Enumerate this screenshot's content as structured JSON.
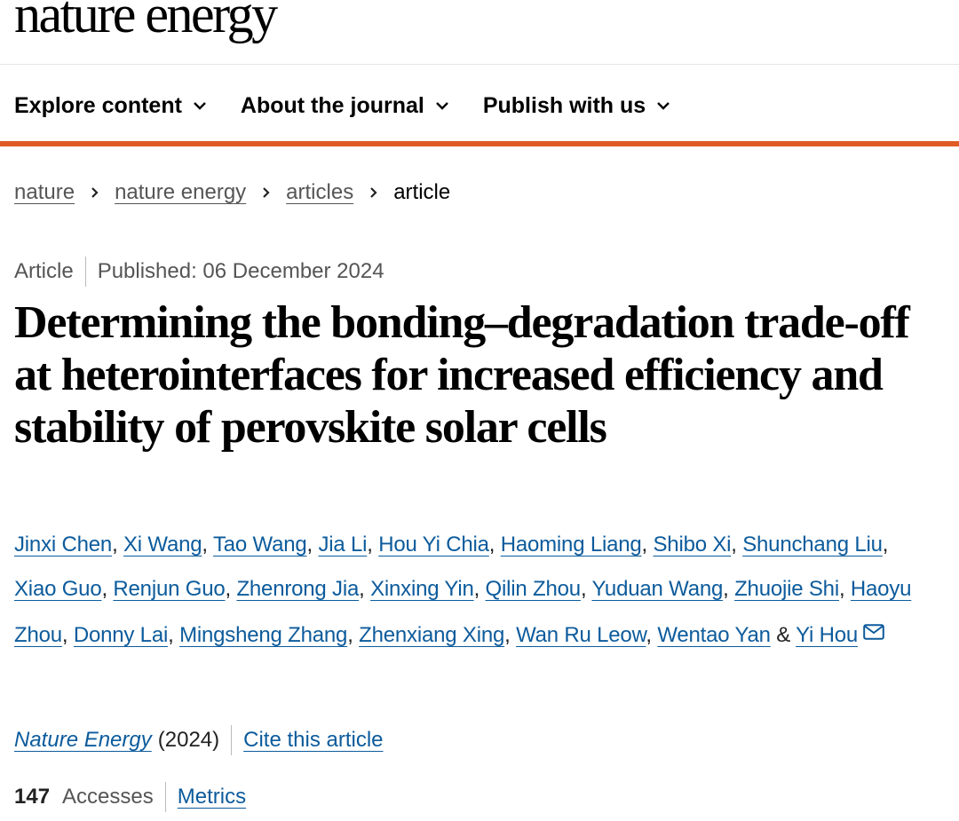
{
  "header": {
    "logo_text": "nature energy"
  },
  "nav": {
    "items": [
      {
        "label": "Explore content"
      },
      {
        "label": "About the journal"
      },
      {
        "label": "Publish with us"
      }
    ]
  },
  "breadcrumb": {
    "items": [
      {
        "label": "nature"
      },
      {
        "label": "nature energy"
      },
      {
        "label": "articles"
      },
      {
        "label": "article"
      }
    ]
  },
  "article": {
    "type": "Article",
    "published": "Published: 06 December 2024",
    "title": "Determining the bonding–degradation trade-off at heterointerfaces for increased efficiency and stability of perovskite solar cells",
    "authors": [
      "Jinxi Chen",
      "Xi Wang",
      "Tao Wang",
      "Jia Li",
      "Hou Yi Chia",
      "Haoming Liang",
      "Shibo Xi",
      "Shunchang Liu",
      "Xiao Guo",
      "Renjun Guo",
      "Zhenrong Jia",
      "Xinxing Yin",
      "Qilin Zhou",
      "Yuduan Wang",
      "Zhuojie Shi",
      "Haoyu Zhou",
      "Donny Lai",
      "Mingsheng Zhang",
      "Zhenxiang Xing",
      "Wan Ru Leow",
      "Wentao Yan",
      "Yi Hou"
    ],
    "author_separator": ", ",
    "author_last_separator": " & ",
    "journal_name": "Nature Energy",
    "year": "(2024)",
    "cite_label": "Cite this article",
    "accesses_count": "147",
    "accesses_label": "Accesses",
    "metrics_label": "Metrics"
  },
  "icons": {
    "nav_chevron": "chevron-down-icon",
    "breadcrumb_separator": "chevron-right-icon",
    "corresponding_author": "mail-icon"
  },
  "colors": {
    "accent_bar": "#e05b26",
    "link": "#0c5b9c"
  }
}
